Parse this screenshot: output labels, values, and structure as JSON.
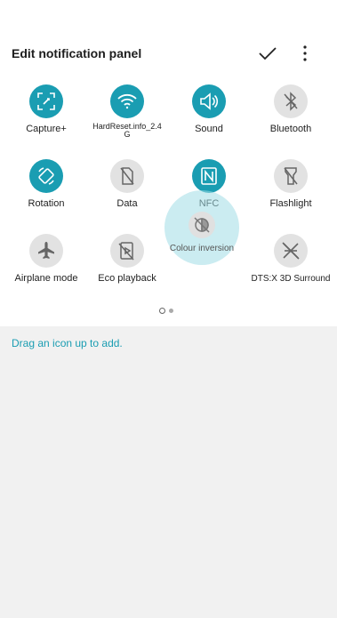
{
  "header": {
    "title": "Edit notification panel",
    "confirm_icon": "check-icon",
    "more_icon": "more-vertical-icon"
  },
  "tiles": [
    {
      "label": "Capture+",
      "icon": "capture-icon",
      "state": "on"
    },
    {
      "label": "HardReset.info_2.4G",
      "icon": "wifi-icon",
      "state": "on"
    },
    {
      "label": "Sound",
      "icon": "sound-icon",
      "state": "on"
    },
    {
      "label": "Bluetooth",
      "icon": "bluetooth-icon",
      "state": "off"
    },
    {
      "label": "Rotation",
      "icon": "rotation-icon",
      "state": "on"
    },
    {
      "label": "Data",
      "icon": "data-icon",
      "state": "off"
    },
    {
      "label": "NFC",
      "icon": "nfc-icon",
      "state": "on"
    },
    {
      "label": "Flashlight",
      "icon": "flashlight-icon",
      "state": "off"
    },
    {
      "label": "Airplane mode",
      "icon": "airplane-icon",
      "state": "off"
    },
    {
      "label": "Eco playback",
      "icon": "eco-playback-icon",
      "state": "off"
    },
    {
      "label": "DTS:X 3D Surround",
      "icon": "dts-surround-icon",
      "state": "off"
    }
  ],
  "dragging_tile": {
    "label": "Colour inversion",
    "icon": "colour-inversion-icon"
  },
  "pager": {
    "current": 1,
    "total": 2
  },
  "hint": "Drag an icon up to add.",
  "colors": {
    "accent": "#1a9db2",
    "inactive": "#e2e2e2",
    "background": "#f1f1f1"
  }
}
